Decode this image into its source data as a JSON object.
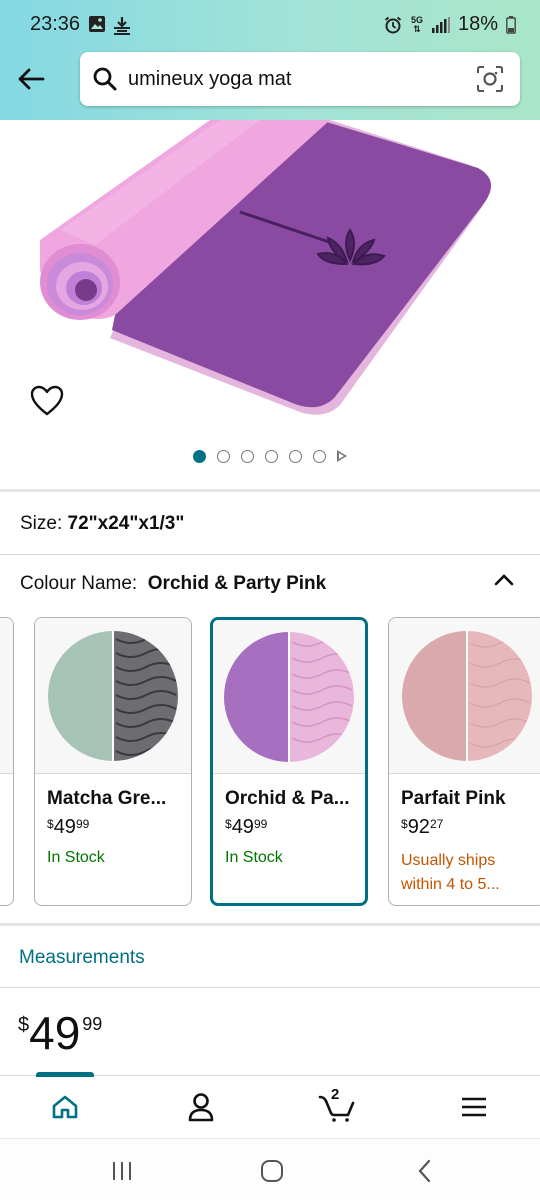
{
  "status_bar": {
    "time": "23:36",
    "network_top": "5G",
    "battery": "18%"
  },
  "search": {
    "query": "umineux yoga mat"
  },
  "product": {
    "size_label": "Size:",
    "size_value": "72\"x24\"x1/3\"",
    "colour_label": "Colour Name:",
    "colour_value": "Orchid & Party Pink",
    "image_count": 6,
    "active_image_index": 0
  },
  "swatches": [
    {
      "name": "Matcha Gre...",
      "price_symbol": "$",
      "price_whole": "49",
      "price_cents": "99",
      "stock": "In Stock",
      "colors": [
        "#a4c4b5",
        "#6e6e72"
      ]
    },
    {
      "name": "Orchid & Pa...",
      "price_symbol": "$",
      "price_whole": "49",
      "price_cents": "99",
      "stock": "In Stock",
      "selected": true,
      "colors": [
        "#a66fbf",
        "#e9b6db"
      ]
    },
    {
      "name": "Parfait Pink",
      "price_symbol": "$",
      "price_whole": "92",
      "price_cents": "27",
      "stock_line1": "Usually ships",
      "stock_line2": "within 4 to 5...",
      "colors": [
        "#d9a9ad",
        "#e8b9bd"
      ]
    }
  ],
  "measurements_label": "Measurements",
  "price": {
    "symbol": "$",
    "whole": "49",
    "cents": "99"
  },
  "bottom_nav": {
    "cart_count": "2",
    "active": "home"
  },
  "colors": {
    "accent": "#007185",
    "in_stock": "#007600",
    "ships_later": "#c45500"
  }
}
